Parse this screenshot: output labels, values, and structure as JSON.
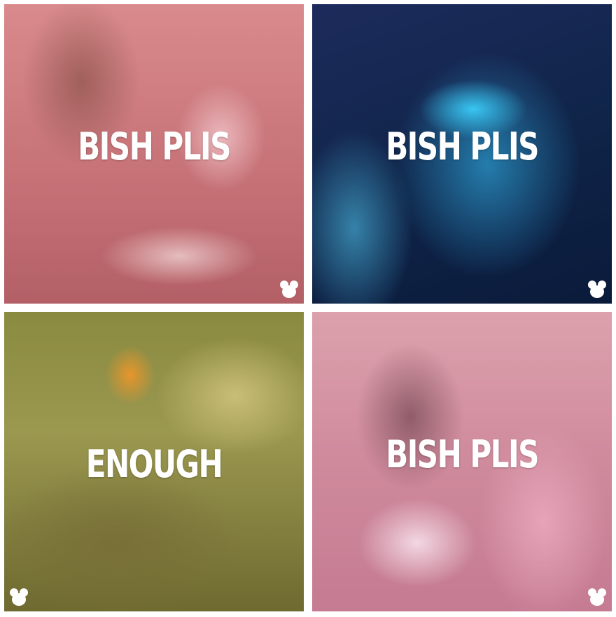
{
  "tiles": [
    {
      "caption": "BISH PLIS"
    },
    {
      "caption": "BISH PLIS"
    },
    {
      "caption": "ENOUGH"
    },
    {
      "caption": "BISH PLIS"
    }
  ],
  "colors": {
    "caption_text": "#ffffff",
    "tile1_tint": "#c77378",
    "tile2_tint": "#10254a",
    "tile3_tint": "#8a8a40",
    "tile4_tint": "#cf8a9c"
  },
  "icons": {
    "watermark": "mouse-head-logo"
  }
}
